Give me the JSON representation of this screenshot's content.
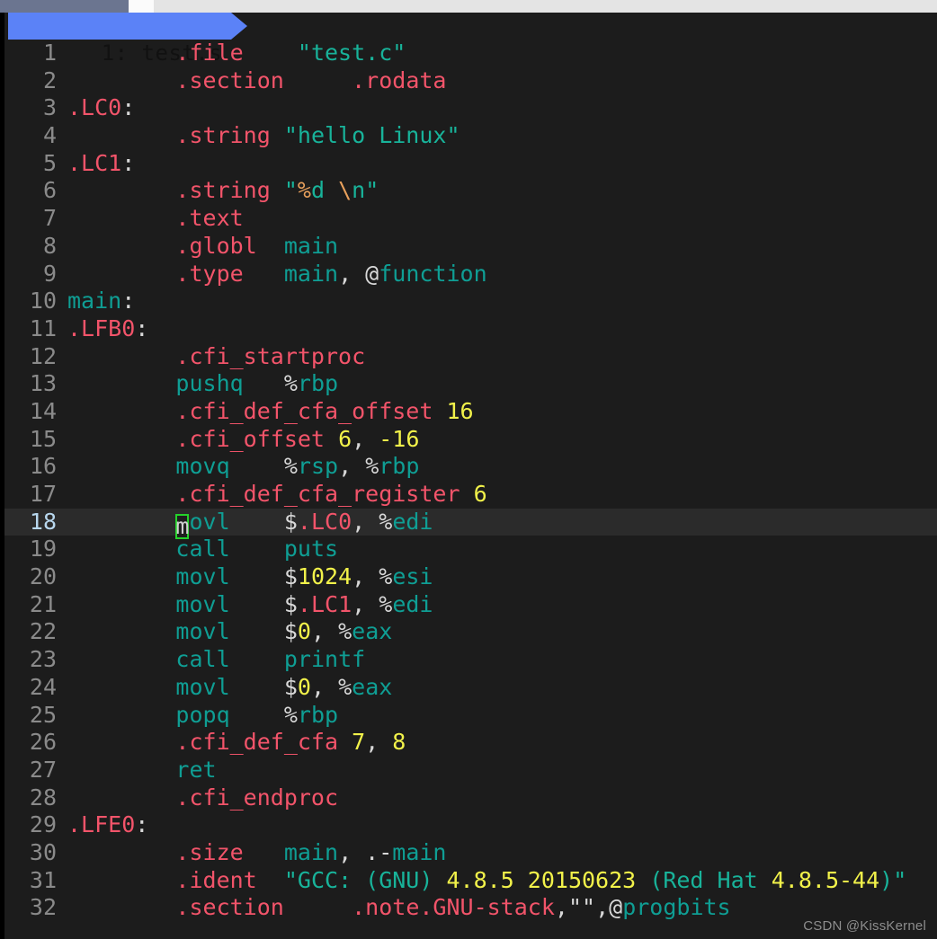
{
  "window": {
    "strip_segments": [
      "active-window-chrome",
      "white-gap",
      "light-gray-fill"
    ]
  },
  "tabline": {
    "tabs": [
      {
        "label": "1: test.s",
        "active": true
      }
    ]
  },
  "editor": {
    "filetype": "asm",
    "cursor": {
      "line": 18,
      "column": 5,
      "char": "m"
    },
    "colors": {
      "background": "#1c1c1c",
      "cursorline": "#2b2b2b",
      "linenr": "#8a8a8a",
      "cursor_linenr": "#b8d7ee",
      "tab_active_bg": "#5b82f7",
      "tab_active_fg": "#111111",
      "cursor_border": "#24d22a",
      "directive": "#f2546a",
      "string": "#18b39a",
      "identifier": "#0f9e94",
      "number": "#f2f24a",
      "plain": "#d8d8d8",
      "escape": "#e8a05c"
    },
    "lines": [
      {
        "n": "1",
        "tokens": [
          {
            "t": "        ",
            "c": "pln"
          },
          {
            "t": ".file",
            "c": "dir"
          },
          {
            "t": "    ",
            "c": "pln"
          },
          {
            "t": "\"test.c\"",
            "c": "str"
          }
        ]
      },
      {
        "n": "2",
        "tokens": [
          {
            "t": "        ",
            "c": "pln"
          },
          {
            "t": ".section",
            "c": "dir"
          },
          {
            "t": "     ",
            "c": "pln"
          },
          {
            "t": ".rodata",
            "c": "dir"
          }
        ]
      },
      {
        "n": "3",
        "tokens": [
          {
            "t": ".LC0",
            "c": "dir"
          },
          {
            "t": ":",
            "c": "pln"
          }
        ]
      },
      {
        "n": "4",
        "tokens": [
          {
            "t": "        ",
            "c": "pln"
          },
          {
            "t": ".string",
            "c": "dir"
          },
          {
            "t": " ",
            "c": "pln"
          },
          {
            "t": "\"hello Linux\"",
            "c": "str"
          }
        ]
      },
      {
        "n": "5",
        "tokens": [
          {
            "t": ".LC1",
            "c": "dir"
          },
          {
            "t": ":",
            "c": "pln"
          }
        ]
      },
      {
        "n": "6",
        "tokens": [
          {
            "t": "        ",
            "c": "pln"
          },
          {
            "t": ".string",
            "c": "dir"
          },
          {
            "t": " ",
            "c": "pln"
          },
          {
            "t": "\"",
            "c": "str"
          },
          {
            "t": "%",
            "c": "esc"
          },
          {
            "t": "d ",
            "c": "str"
          },
          {
            "t": "\\",
            "c": "esc"
          },
          {
            "t": "n",
            "c": "str"
          },
          {
            "t": "\"",
            "c": "str"
          }
        ]
      },
      {
        "n": "7",
        "tokens": [
          {
            "t": "        ",
            "c": "pln"
          },
          {
            "t": ".text",
            "c": "dir"
          }
        ]
      },
      {
        "n": "8",
        "tokens": [
          {
            "t": "        ",
            "c": "pln"
          },
          {
            "t": ".globl",
            "c": "dir"
          },
          {
            "t": "  ",
            "c": "pln"
          },
          {
            "t": "main",
            "c": "id"
          }
        ]
      },
      {
        "n": "9",
        "tokens": [
          {
            "t": "        ",
            "c": "pln"
          },
          {
            "t": ".type",
            "c": "dir"
          },
          {
            "t": "   ",
            "c": "pln"
          },
          {
            "t": "main",
            "c": "id"
          },
          {
            "t": ", ",
            "c": "pln"
          },
          {
            "t": "@",
            "c": "pln"
          },
          {
            "t": "function",
            "c": "id"
          }
        ]
      },
      {
        "n": "10",
        "tokens": [
          {
            "t": "main",
            "c": "id"
          },
          {
            "t": ":",
            "c": "pln"
          }
        ]
      },
      {
        "n": "11",
        "tokens": [
          {
            "t": ".LFB0",
            "c": "dir"
          },
          {
            "t": ":",
            "c": "pln"
          }
        ]
      },
      {
        "n": "12",
        "tokens": [
          {
            "t": "        ",
            "c": "pln"
          },
          {
            "t": ".cfi_startproc",
            "c": "dir"
          }
        ]
      },
      {
        "n": "13",
        "tokens": [
          {
            "t": "        ",
            "c": "pln"
          },
          {
            "t": "pushq",
            "c": "id"
          },
          {
            "t": "   ",
            "c": "pln"
          },
          {
            "t": "%",
            "c": "pln"
          },
          {
            "t": "rbp",
            "c": "id"
          }
        ]
      },
      {
        "n": "14",
        "tokens": [
          {
            "t": "        ",
            "c": "pln"
          },
          {
            "t": ".cfi_def_cfa_offset",
            "c": "dir"
          },
          {
            "t": " ",
            "c": "pln"
          },
          {
            "t": "16",
            "c": "num"
          }
        ]
      },
      {
        "n": "15",
        "tokens": [
          {
            "t": "        ",
            "c": "pln"
          },
          {
            "t": ".cfi_offset",
            "c": "dir"
          },
          {
            "t": " ",
            "c": "pln"
          },
          {
            "t": "6",
            "c": "num"
          },
          {
            "t": ", ",
            "c": "pln"
          },
          {
            "t": "-16",
            "c": "num"
          }
        ]
      },
      {
        "n": "16",
        "tokens": [
          {
            "t": "        ",
            "c": "pln"
          },
          {
            "t": "movq",
            "c": "id"
          },
          {
            "t": "    ",
            "c": "pln"
          },
          {
            "t": "%",
            "c": "pln"
          },
          {
            "t": "rsp",
            "c": "id"
          },
          {
            "t": ", ",
            "c": "pln"
          },
          {
            "t": "%",
            "c": "pln"
          },
          {
            "t": "rbp",
            "c": "id"
          }
        ]
      },
      {
        "n": "17",
        "tokens": [
          {
            "t": "        ",
            "c": "pln"
          },
          {
            "t": ".cfi_def_cfa_register",
            "c": "dir"
          },
          {
            "t": " ",
            "c": "pln"
          },
          {
            "t": "6",
            "c": "num"
          }
        ]
      },
      {
        "n": "18",
        "cursorline": true,
        "tokens": [
          {
            "t": "        ",
            "c": "pln"
          },
          {
            "t": "m",
            "c": "id",
            "cursor": true
          },
          {
            "t": "ovl",
            "c": "id"
          },
          {
            "t": "    ",
            "c": "pln"
          },
          {
            "t": "$",
            "c": "pln"
          },
          {
            "t": ".LC0",
            "c": "dir"
          },
          {
            "t": ", ",
            "c": "pln"
          },
          {
            "t": "%",
            "c": "pln"
          },
          {
            "t": "edi",
            "c": "id"
          }
        ]
      },
      {
        "n": "19",
        "tokens": [
          {
            "t": "        ",
            "c": "pln"
          },
          {
            "t": "call",
            "c": "id"
          },
          {
            "t": "    ",
            "c": "pln"
          },
          {
            "t": "puts",
            "c": "id"
          }
        ]
      },
      {
        "n": "20",
        "tokens": [
          {
            "t": "        ",
            "c": "pln"
          },
          {
            "t": "movl",
            "c": "id"
          },
          {
            "t": "    ",
            "c": "pln"
          },
          {
            "t": "$",
            "c": "pln"
          },
          {
            "t": "1024",
            "c": "num"
          },
          {
            "t": ", ",
            "c": "pln"
          },
          {
            "t": "%",
            "c": "pln"
          },
          {
            "t": "esi",
            "c": "id"
          }
        ]
      },
      {
        "n": "21",
        "tokens": [
          {
            "t": "        ",
            "c": "pln"
          },
          {
            "t": "movl",
            "c": "id"
          },
          {
            "t": "    ",
            "c": "pln"
          },
          {
            "t": "$",
            "c": "pln"
          },
          {
            "t": ".LC1",
            "c": "dir"
          },
          {
            "t": ", ",
            "c": "pln"
          },
          {
            "t": "%",
            "c": "pln"
          },
          {
            "t": "edi",
            "c": "id"
          }
        ]
      },
      {
        "n": "22",
        "tokens": [
          {
            "t": "        ",
            "c": "pln"
          },
          {
            "t": "movl",
            "c": "id"
          },
          {
            "t": "    ",
            "c": "pln"
          },
          {
            "t": "$",
            "c": "pln"
          },
          {
            "t": "0",
            "c": "num"
          },
          {
            "t": ", ",
            "c": "pln"
          },
          {
            "t": "%",
            "c": "pln"
          },
          {
            "t": "eax",
            "c": "id"
          }
        ]
      },
      {
        "n": "23",
        "tokens": [
          {
            "t": "        ",
            "c": "pln"
          },
          {
            "t": "call",
            "c": "id"
          },
          {
            "t": "    ",
            "c": "pln"
          },
          {
            "t": "printf",
            "c": "id"
          }
        ]
      },
      {
        "n": "24",
        "tokens": [
          {
            "t": "        ",
            "c": "pln"
          },
          {
            "t": "movl",
            "c": "id"
          },
          {
            "t": "    ",
            "c": "pln"
          },
          {
            "t": "$",
            "c": "pln"
          },
          {
            "t": "0",
            "c": "num"
          },
          {
            "t": ", ",
            "c": "pln"
          },
          {
            "t": "%",
            "c": "pln"
          },
          {
            "t": "eax",
            "c": "id"
          }
        ]
      },
      {
        "n": "25",
        "tokens": [
          {
            "t": "        ",
            "c": "pln"
          },
          {
            "t": "popq",
            "c": "id"
          },
          {
            "t": "    ",
            "c": "pln"
          },
          {
            "t": "%",
            "c": "pln"
          },
          {
            "t": "rbp",
            "c": "id"
          }
        ]
      },
      {
        "n": "26",
        "tokens": [
          {
            "t": "        ",
            "c": "pln"
          },
          {
            "t": ".cfi_def_cfa",
            "c": "dir"
          },
          {
            "t": " ",
            "c": "pln"
          },
          {
            "t": "7",
            "c": "num"
          },
          {
            "t": ", ",
            "c": "pln"
          },
          {
            "t": "8",
            "c": "num"
          }
        ]
      },
      {
        "n": "27",
        "tokens": [
          {
            "t": "        ",
            "c": "pln"
          },
          {
            "t": "ret",
            "c": "id"
          }
        ]
      },
      {
        "n": "28",
        "tokens": [
          {
            "t": "        ",
            "c": "pln"
          },
          {
            "t": ".cfi_endproc",
            "c": "dir"
          }
        ]
      },
      {
        "n": "29",
        "tokens": [
          {
            "t": ".LFE0",
            "c": "dir"
          },
          {
            "t": ":",
            "c": "pln"
          }
        ]
      },
      {
        "n": "30",
        "tokens": [
          {
            "t": "        ",
            "c": "pln"
          },
          {
            "t": ".size",
            "c": "dir"
          },
          {
            "t": "   ",
            "c": "pln"
          },
          {
            "t": "main",
            "c": "id"
          },
          {
            "t": ", ",
            "c": "pln"
          },
          {
            "t": ".-",
            "c": "pln"
          },
          {
            "t": "main",
            "c": "id"
          }
        ]
      },
      {
        "n": "31",
        "tokens": [
          {
            "t": "        ",
            "c": "pln"
          },
          {
            "t": ".ident",
            "c": "dir"
          },
          {
            "t": "  ",
            "c": "pln"
          },
          {
            "t": "\"GCC: (GNU) ",
            "c": "str"
          },
          {
            "t": "4.8.5",
            "c": "num"
          },
          {
            "t": " ",
            "c": "str"
          },
          {
            "t": "20150623",
            "c": "num"
          },
          {
            "t": " (Red Hat ",
            "c": "str"
          },
          {
            "t": "4.8.5-44",
            "c": "num"
          },
          {
            "t": ")\"",
            "c": "str"
          }
        ]
      },
      {
        "n": "32",
        "tokens": [
          {
            "t": "        ",
            "c": "pln"
          },
          {
            "t": ".section",
            "c": "dir"
          },
          {
            "t": "     ",
            "c": "pln"
          },
          {
            "t": ".note.GNU-stack",
            "c": "dir"
          },
          {
            "t": ",",
            "c": "pln"
          },
          {
            "t": "\"\"",
            "c": "pln"
          },
          {
            "t": ",",
            "c": "pln"
          },
          {
            "t": "@",
            "c": "pln"
          },
          {
            "t": "progbits",
            "c": "id"
          }
        ]
      }
    ]
  },
  "watermark": {
    "text": "CSDN @KissKernel"
  }
}
